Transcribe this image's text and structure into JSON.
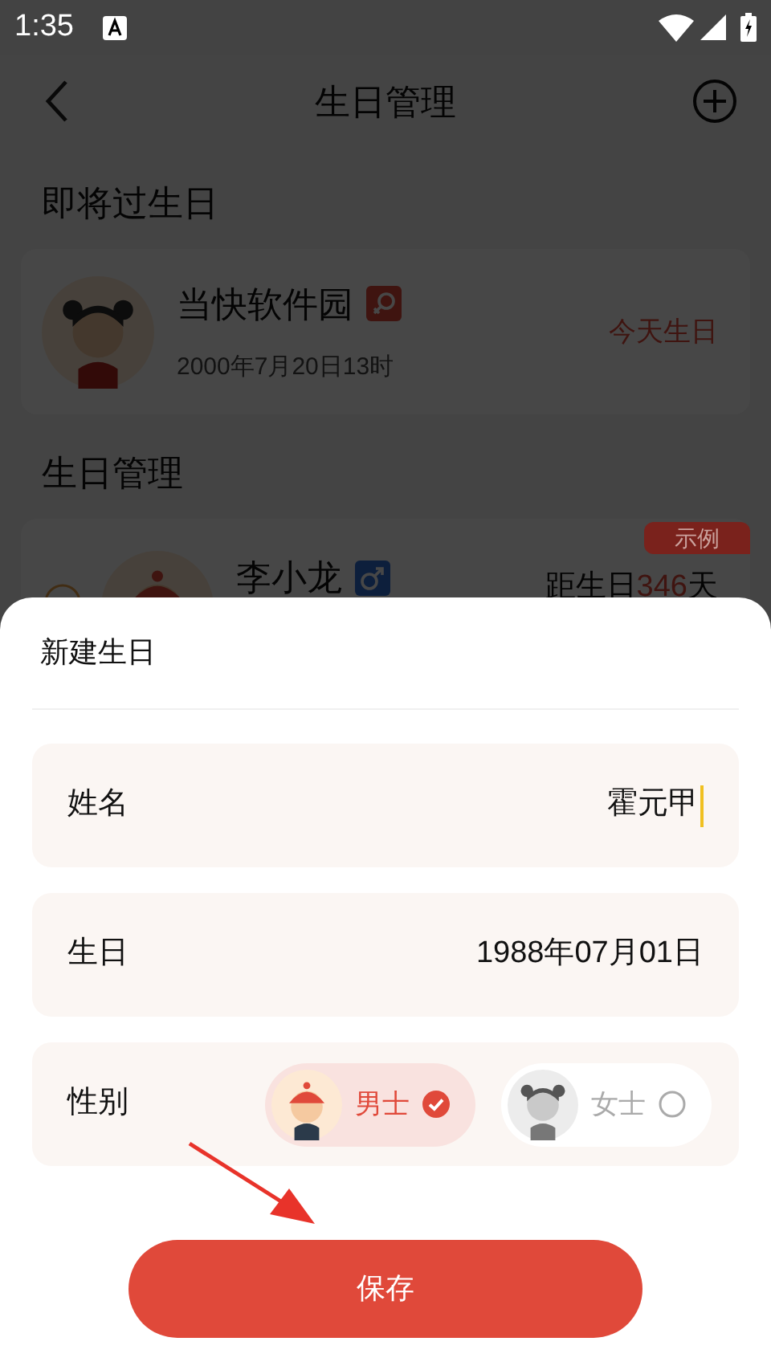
{
  "status_bar": {
    "time": "1:35"
  },
  "header": {
    "title": "生日管理"
  },
  "upcoming": {
    "heading": "即将过生日",
    "items": [
      {
        "name": "当快软件园",
        "kind": "female",
        "date": "2000年7月20日13时",
        "status": "今天生日"
      }
    ]
  },
  "manage": {
    "heading": "生日管理",
    "items": [
      {
        "name": "李小龙",
        "kind": "male",
        "tag": "示例",
        "countdown_prefix": "距生日",
        "countdown_days": "346",
        "countdown_suffix": "天"
      }
    ]
  },
  "sheet": {
    "title": "新建生日",
    "fields": [
      {
        "kind": "text",
        "label": "姓名",
        "value": "霍元甲",
        "focused": true
      },
      {
        "kind": "text",
        "label": "生日",
        "value": "1988年07月01日",
        "focused": false
      },
      {
        "kind": "gender",
        "label": "性别",
        "options": [
          {
            "label": "男士",
            "kind": "male",
            "selected": true
          },
          {
            "label": "女士",
            "kind": "female",
            "selected": false
          }
        ]
      }
    ],
    "save_button": "保存"
  }
}
